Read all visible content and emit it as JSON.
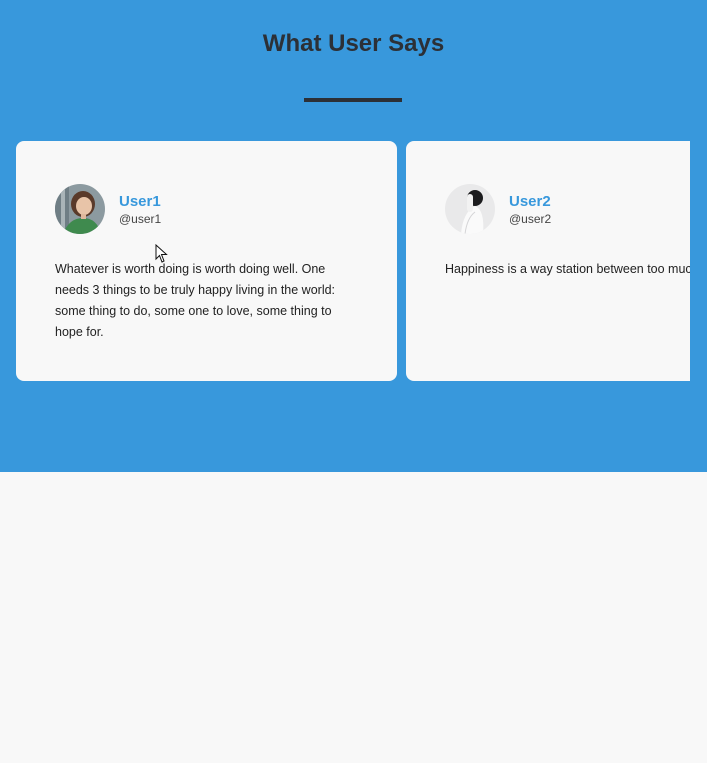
{
  "section": {
    "title": "What User Says"
  },
  "testimonials": [
    {
      "name": "User1",
      "handle": "@user1",
      "quote": "Whatever is worth doing is worth doing well. One needs 3 things to be truly happy living in the world: some thing to do, some one to love, some thing to hope for.",
      "avatar_icon": "woman-portrait-avatar"
    },
    {
      "name": "User2",
      "handle": "@user2",
      "quote": "Happiness is a way station between too much and too little.",
      "avatar_icon": "person-white-clothes-avatar"
    }
  ],
  "colors": {
    "hero_background": "#3898dc",
    "title": "#2c3036",
    "accent": "#3898dc",
    "card_background": "#f8f8f8",
    "page_background": "#f8f8f8"
  }
}
